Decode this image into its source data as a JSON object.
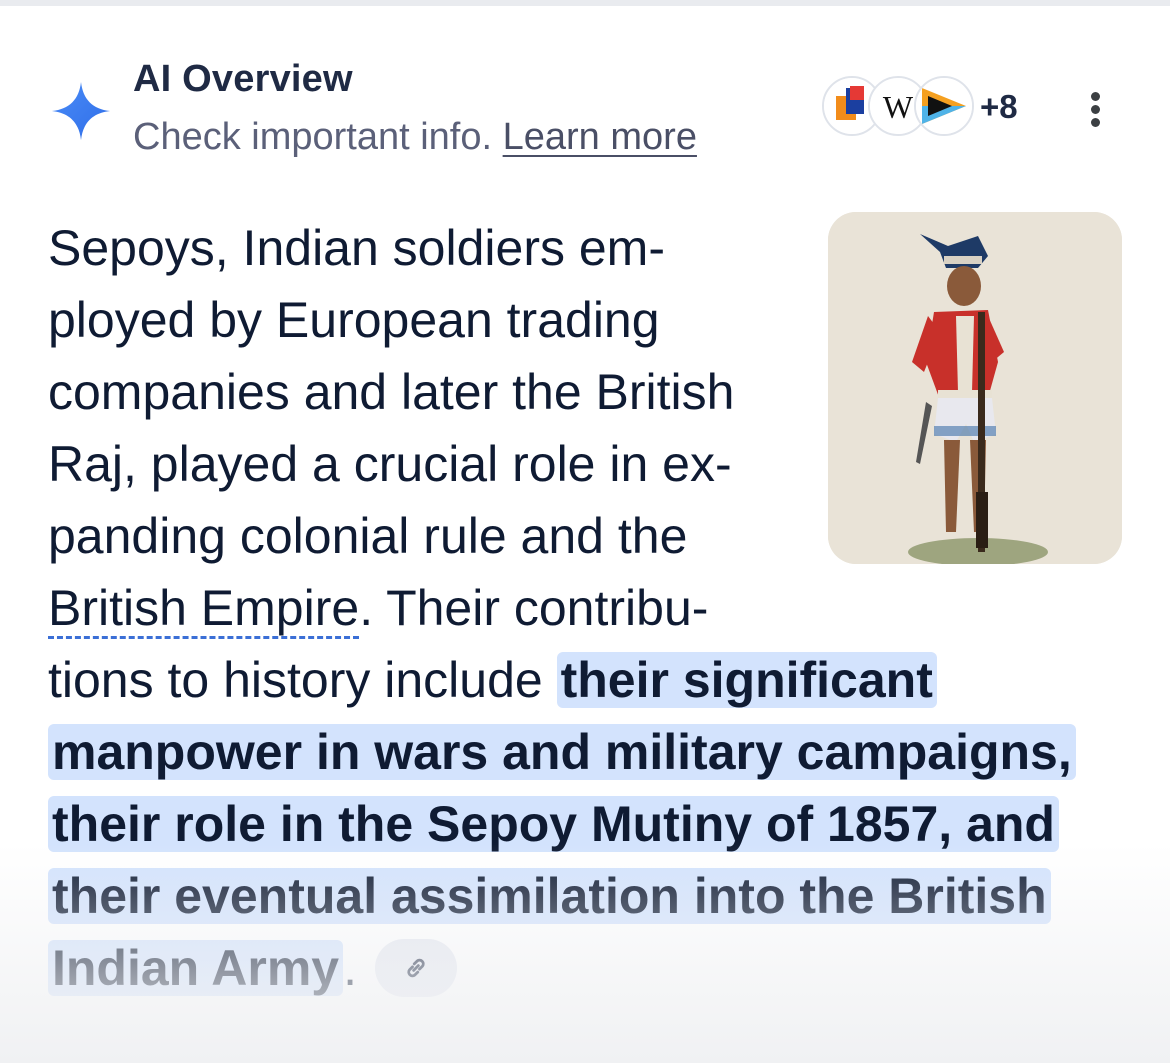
{
  "header": {
    "title": "AI Overview",
    "subtitle": "Check important info.",
    "learn_more": "Learn more"
  },
  "sources": {
    "icons": [
      "source-logo-icon",
      "wikipedia-logo-icon",
      "play-logo-icon"
    ],
    "more_count": "+8"
  },
  "answer": {
    "lines": [
      "Sepoys, Indian soldiers em-",
      "ployed by European trading",
      "companies and later the British",
      "Raj, played a crucial role in ex-",
      "panding colonial rule and the"
    ],
    "entity_link": "British Empire",
    "after_link": ". Their contribu-",
    "line7_plain": "tions to history include ",
    "highlight_lines": [
      "their significant",
      "manpower in wars and military campaigns,",
      "their role in the Sepoy Mutiny of 1857, and",
      "their eventual assimilation into the British",
      "Indian Army"
    ],
    "end_punct": "."
  },
  "colors": {
    "accent_blue": "#3b6fd6",
    "highlight": "#d3e3fd",
    "text": "#0f1b33",
    "muted": "#5b6079"
  }
}
